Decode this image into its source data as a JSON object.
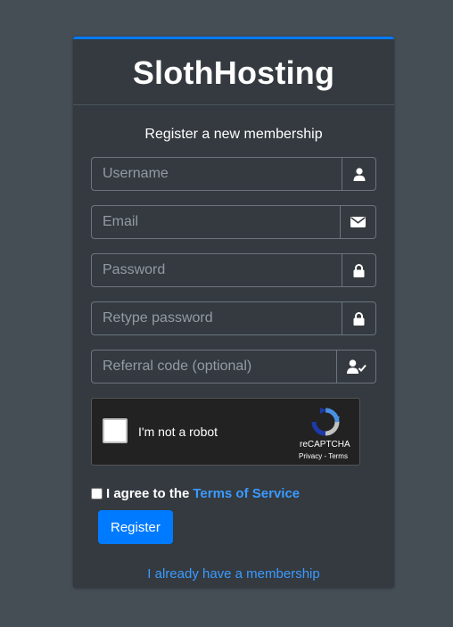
{
  "brand": {
    "name": "SlothHosting"
  },
  "form": {
    "message": "Register a new membership",
    "fields": {
      "username_placeholder": "Username",
      "email_placeholder": "Email",
      "password_placeholder": "Password",
      "retype_placeholder": "Retype password",
      "referral_placeholder": "Referral code (optional)"
    },
    "icons": {
      "username": "user-icon",
      "email": "envelope-icon",
      "password": "lock-icon",
      "retype": "lock-icon",
      "referral": "user-check-icon"
    },
    "recaptcha": {
      "label": "I'm not a robot",
      "brand": "reCAPTCHA",
      "links": "Privacy - Terms",
      "checked": false
    },
    "agree": {
      "text": "I agree to the",
      "link_label": "Terms of Service",
      "checked": false
    },
    "submit_label": "Register",
    "login_link": "I already have a membership"
  },
  "colors": {
    "background": "#454d55",
    "card": "#343a40",
    "accent": "#007bff",
    "link": "#3b9bff"
  }
}
